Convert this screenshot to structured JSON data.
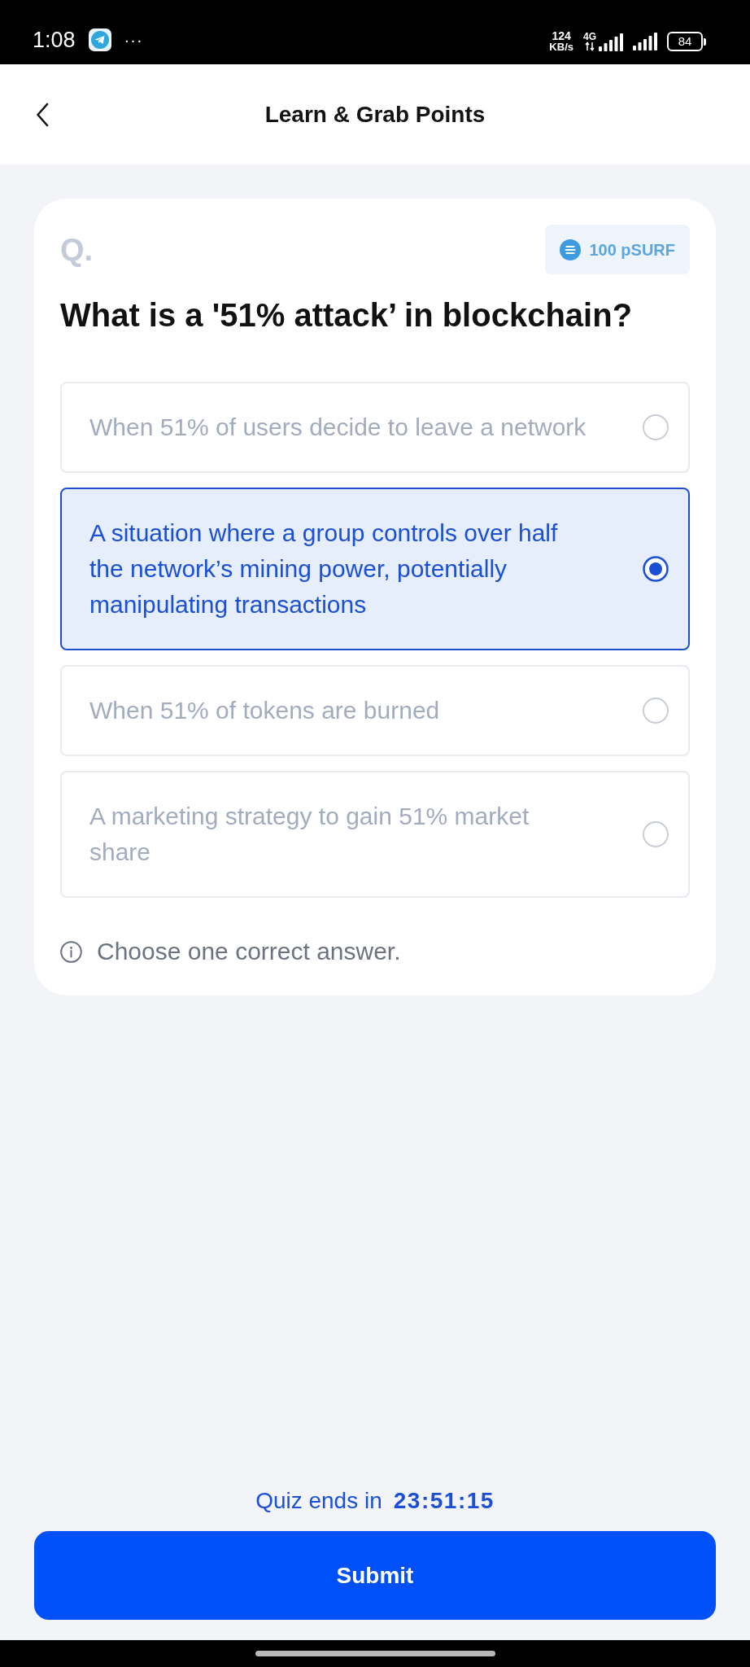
{
  "status_bar": {
    "time": "1:08",
    "more_notifications": "···",
    "network_speed": {
      "value": "124",
      "unit": "KB/s"
    },
    "network_type": "4G",
    "battery": "84"
  },
  "header": {
    "title": "Learn & Grab Points"
  },
  "question": {
    "label": "Q.",
    "reward": "100 pSURF",
    "text": "What is a '51% attack’ in blockchain?",
    "options": [
      {
        "text": "When 51% of users decide to leave a network",
        "selected": false
      },
      {
        "text": "A situation where a group controls over half the network’s mining power, potentially manipulating transactions",
        "selected": true
      },
      {
        "text": "When 51% of tokens are burned",
        "selected": false
      },
      {
        "text": "A marketing strategy to gain 51% market share",
        "selected": false
      }
    ],
    "hint": "Choose one correct answer."
  },
  "footer": {
    "countdown_label": "Quiz ends in",
    "countdown": "23:51:15",
    "submit": "Submit"
  }
}
